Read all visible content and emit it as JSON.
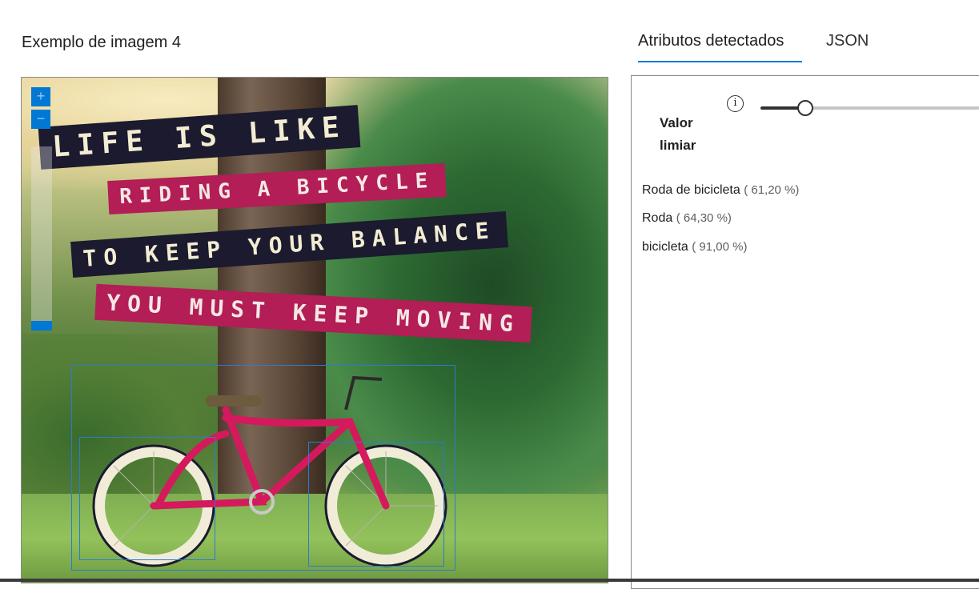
{
  "left": {
    "title": "Exemplo de imagem 4",
    "zoom": {
      "in_label": "+",
      "out_label": "−"
    },
    "image_text": {
      "line1": "LIFE IS LIKE",
      "line2": "RIDING A BICYCLE",
      "line3": "TO KEEP YOUR BALANCE",
      "line4": "YOU MUST KEEP MOVING"
    }
  },
  "tabs": [
    {
      "label": "Atributos detectados",
      "active": true
    },
    {
      "label": "JSON",
      "active": false
    }
  ],
  "threshold": {
    "label_line1": "Valor",
    "label_line2": "limiar",
    "info_icon": "info-icon",
    "info_glyph": "i",
    "value_fraction": 0.2
  },
  "attributes": [
    {
      "name": "Roda de bicicleta",
      "confidence": "( 61,20 %)"
    },
    {
      "name": "Roda",
      "confidence": "( 64,30 %)"
    },
    {
      "name": "bicicleta",
      "confidence": "( 91,00 %)"
    }
  ],
  "colors": {
    "accent": "#0078d4",
    "box": "#2b7bd0",
    "bike": "#d5195d"
  }
}
